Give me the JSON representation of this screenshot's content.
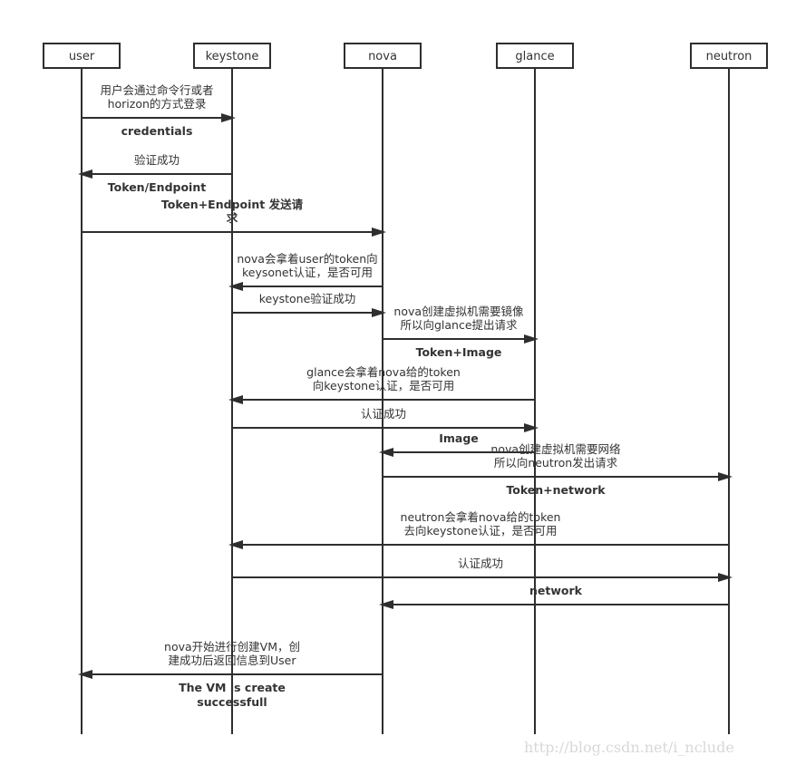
{
  "diagram": {
    "type": "sequence",
    "colors": {
      "line": "#2e2e2e",
      "text": "#333333",
      "watermark": "#d8d8d8",
      "background": "#ffffff"
    },
    "actors": [
      {
        "id": "user",
        "label": "user"
      },
      {
        "id": "keystone",
        "label": "keystone"
      },
      {
        "id": "nova",
        "label": "nova"
      },
      {
        "id": "glance",
        "label": "glance"
      },
      {
        "id": "neutron",
        "label": "neutron"
      }
    ],
    "messages": [
      {
        "from": "user",
        "to": "keystone",
        "above": [
          "用户会通过命令行或者",
          "horizon的方式登录"
        ],
        "below": [
          "credentials"
        ]
      },
      {
        "from": "keystone",
        "to": "user",
        "above": [
          "验证成功"
        ],
        "below": [
          "Token/Endpoint"
        ]
      },
      {
        "from": "user",
        "to": "nova",
        "above": [
          "Token+Endpoint 发送请",
          "求"
        ],
        "above_bold": true,
        "below": []
      },
      {
        "from": "nova",
        "to": "keystone",
        "above": [
          "nova会拿着user的token向",
          "keysonet认证，是否可用"
        ],
        "below": []
      },
      {
        "from": "keystone",
        "to": "nova",
        "above": [
          "keystone验证成功"
        ],
        "below": []
      },
      {
        "from": "nova",
        "to": "glance",
        "above": [
          "nova创建虚拟机需要镜像",
          "所以向glance提出请求"
        ],
        "below": [
          "Token+Image"
        ]
      },
      {
        "from": "glance",
        "to": "keystone",
        "above": [
          "glance会拿着nova给的token",
          "向keystone认证，是否可用"
        ],
        "below": []
      },
      {
        "from": "keystone",
        "to": "glance",
        "above": [
          "认证成功"
        ],
        "below": []
      },
      {
        "from": "glance",
        "to": "nova",
        "above": [
          "Image"
        ],
        "above_bold": true,
        "below": []
      },
      {
        "from": "nova",
        "to": "neutron",
        "above": [
          "nova创建虚拟机需要网络",
          "所以向neutron发出请求"
        ],
        "below": [
          "Token+network"
        ]
      },
      {
        "from": "neutron",
        "to": "keystone",
        "above": [
          "neutron会拿着nova给的token",
          "去向keystone认证，是否可用"
        ],
        "below": []
      },
      {
        "from": "keystone",
        "to": "neutron",
        "above": [
          "认证成功"
        ],
        "below": []
      },
      {
        "from": "neutron",
        "to": "nova",
        "above": [
          "network"
        ],
        "above_bold": true,
        "below": []
      },
      {
        "from": "nova",
        "to": "user",
        "above": [
          "nova开始进行创建VM，创",
          "建成功后返回信息到User"
        ],
        "below": [
          "The VM is create",
          "successfull"
        ]
      }
    ]
  },
  "watermark": "http://blog.csdn.net/i_nclude"
}
